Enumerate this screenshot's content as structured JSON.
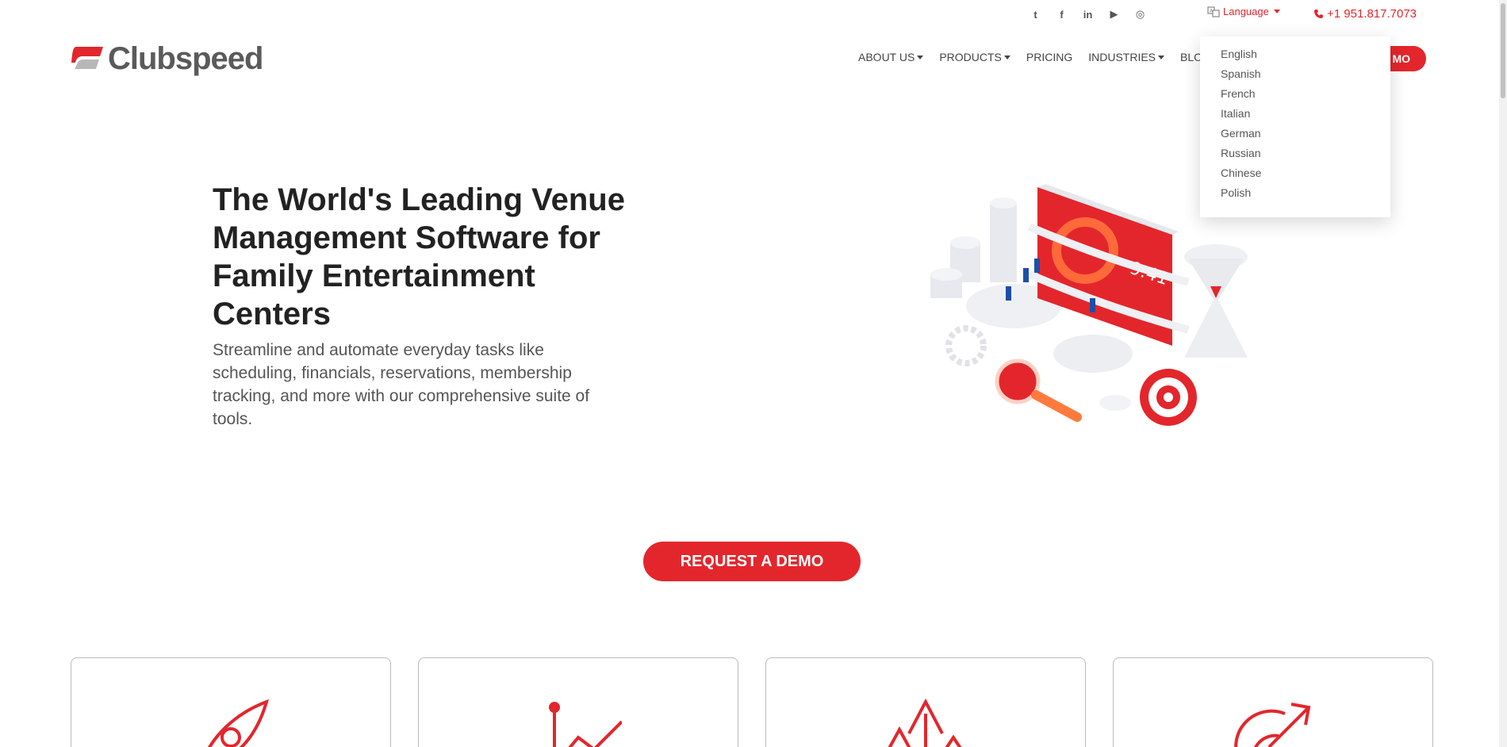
{
  "brand": {
    "name": "Clubspeed",
    "accent": "#e3262c",
    "text_gray": "#5a5a5a"
  },
  "topbar": {
    "social": [
      {
        "icon": "twitter-icon",
        "glyph": "t"
      },
      {
        "icon": "facebook-icon",
        "glyph": "f"
      },
      {
        "icon": "linkedin-icon",
        "glyph": "in"
      },
      {
        "icon": "youtube-icon",
        "glyph": "▶"
      },
      {
        "icon": "instagram-icon",
        "glyph": "◎"
      }
    ],
    "language_label": "Language",
    "phone": "+1 951.817.7073"
  },
  "nav": {
    "items": [
      {
        "label": "ABOUT US",
        "dropdown": true
      },
      {
        "label": "PRODUCTS",
        "dropdown": true
      },
      {
        "label": "PRICING",
        "dropdown": false
      },
      {
        "label": "INDUSTRIES",
        "dropdown": true
      },
      {
        "label": "BLOG",
        "dropdown": false
      }
    ],
    "demo_partial": "MO"
  },
  "language_menu": {
    "options": [
      "English",
      "Spanish",
      "French",
      "Italian",
      "German",
      "Russian",
      "Chinese",
      "Polish"
    ]
  },
  "hero": {
    "title": "The World's Leading Venue Management Software for Family Entertainment Centers",
    "subtitle": "Streamline and automate everyday tasks like scheduling, financials, reservations, membership tracking, and more with our comprehensive suite of tools.",
    "illustration_clock": "9:41"
  },
  "cta": {
    "label": "REQUEST A DEMO"
  },
  "cards": [
    {
      "icon": "rocket-icon"
    },
    {
      "icon": "growth-chart-icon"
    },
    {
      "icon": "up-arrows-icon"
    },
    {
      "icon": "target-arrow-icon"
    }
  ]
}
